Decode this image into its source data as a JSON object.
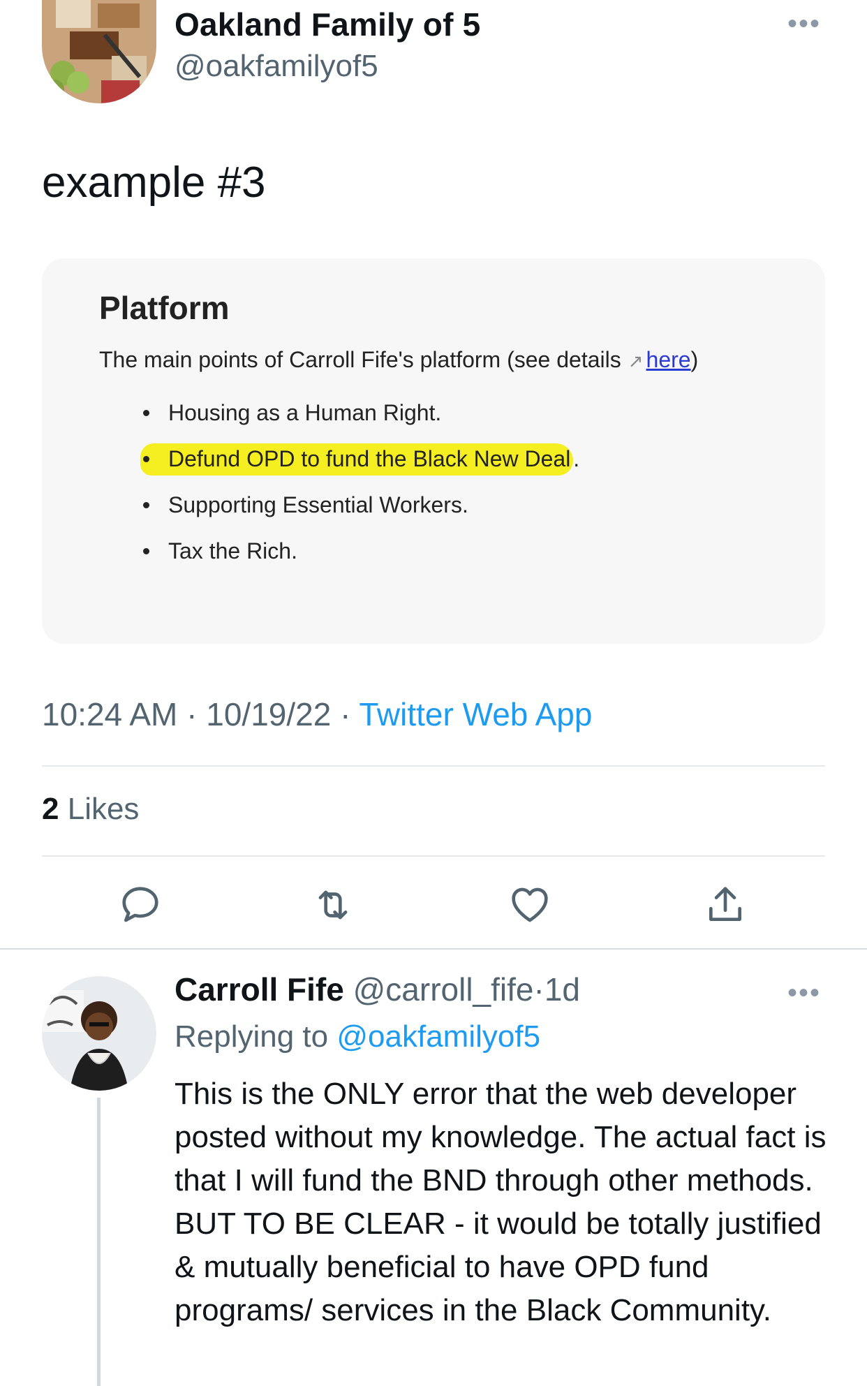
{
  "tweet": {
    "author_name": "Oakland Family of 5",
    "author_handle": "@oakfamilyof5",
    "more_icon": "more-dots-icon",
    "text": "example #3",
    "card": {
      "heading": "Platform",
      "intro": "The main points of Carroll Fife's platform (see details",
      "link_text": "here",
      "intro_close": ")",
      "items": [
        "Housing as a Human Right.",
        "Defund OPD to fund the Black New Deal",
        "Supporting Essential Workers.",
        "Tax the Rich."
      ],
      "highlight_trailing_period": ".",
      "highlight_color": "#f5ee20"
    },
    "time": "10:24 AM",
    "date": "10/19/22",
    "separator": "·",
    "source": "Twitter Web App",
    "likes_count": "2",
    "likes_label": "Likes",
    "actions": [
      "reply-icon",
      "retweet-icon",
      "like-icon",
      "share-icon"
    ]
  },
  "reply": {
    "author_name": "Carroll Fife",
    "author_handle": "@carroll_fife",
    "age": "1d",
    "replying_prefix": "Replying to",
    "replying_handle": "@oakfamilyof5",
    "text": "This is the ONLY error that the web developer posted without my knowledge. The actual fact is that I will fund the BND through other methods. BUT TO BE CLEAR - it would be totally justified & mutually beneficial to have OPD fund programs/ services in the Black Community."
  },
  "colors": {
    "link_blue": "#1d9bf0",
    "secondary_text": "#536471",
    "card_link": "#2a3bd4"
  }
}
